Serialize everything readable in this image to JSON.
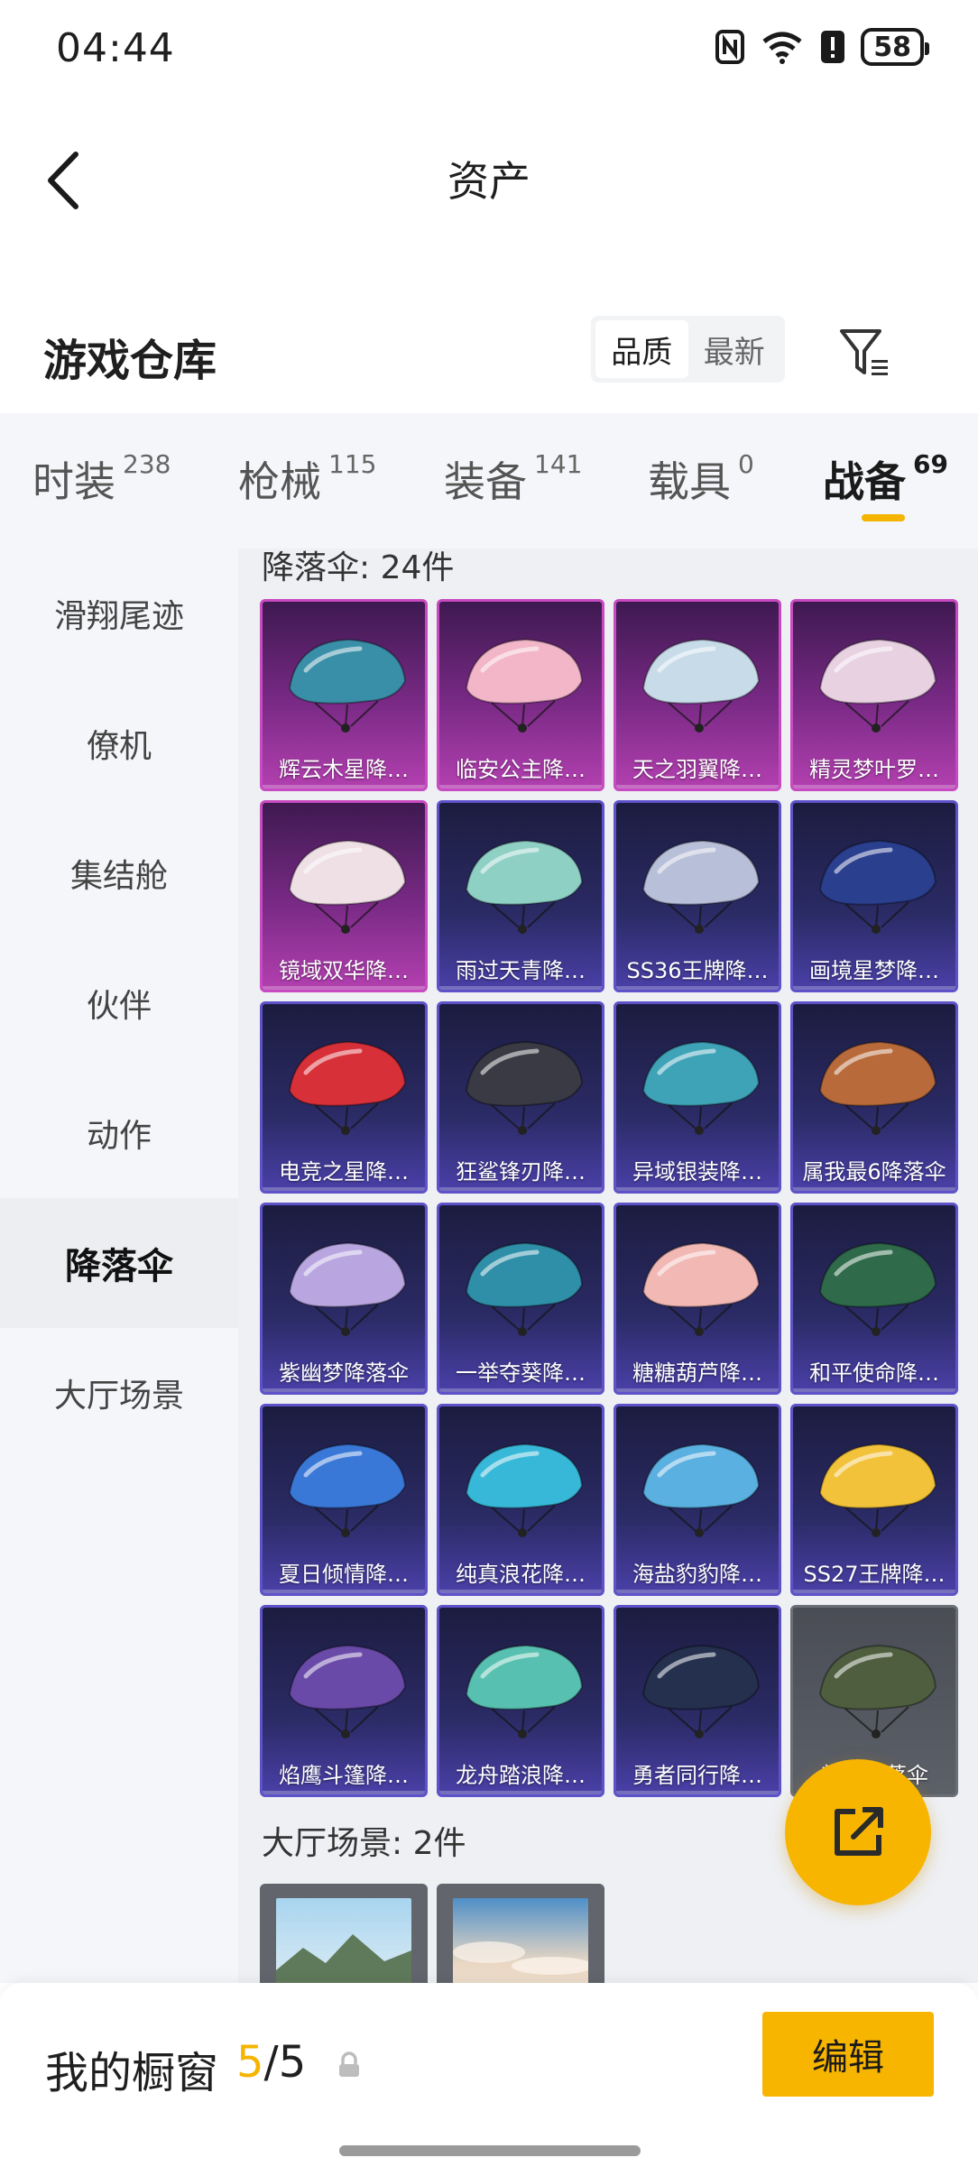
{
  "status_bar": {
    "time": "04:44",
    "battery": "58"
  },
  "header": {
    "title": "资产"
  },
  "warehouse": {
    "title": "游戏仓库",
    "sort_options": [
      "品质",
      "最新"
    ],
    "active_sort": "品质"
  },
  "tabs": [
    {
      "label": "时装",
      "count": "238"
    },
    {
      "label": "枪械",
      "count": "115"
    },
    {
      "label": "装备",
      "count": "141"
    },
    {
      "label": "载具",
      "count": "0"
    },
    {
      "label": "战备",
      "count": "69"
    }
  ],
  "active_tab": "战备",
  "sidebar": {
    "items": [
      "滑翔尾迹",
      "僚机",
      "集结舱",
      "伙伴",
      "动作",
      "降落伞",
      "大厅场景"
    ],
    "active": "降落伞"
  },
  "parachutes": {
    "section_title": "降落伞: 24件",
    "items": [
      {
        "name": "辉云木星降…",
        "rarity": "legend",
        "color": "#3a8fa8"
      },
      {
        "name": "临安公主降…",
        "rarity": "legend",
        "color": "#f2b6c8"
      },
      {
        "name": "天之羽翼降…",
        "rarity": "legend",
        "color": "#c7dbe8"
      },
      {
        "name": "精灵梦叶罗…",
        "rarity": "legend",
        "color": "#e8d2e2"
      },
      {
        "name": "镜域双华降…",
        "rarity": "legend",
        "color": "#efe0e6"
      },
      {
        "name": "雨过天青降…",
        "rarity": "epic",
        "color": "#8fd0c5"
      },
      {
        "name": "SS36王牌降…",
        "rarity": "epic",
        "color": "#b8bfd8"
      },
      {
        "name": "画境星梦降…",
        "rarity": "epic",
        "color": "#2a3f8e"
      },
      {
        "name": "电竞之星降…",
        "rarity": "epic",
        "color": "#d83038"
      },
      {
        "name": "狂鲨锋刃降…",
        "rarity": "epic",
        "color": "#3a3a44"
      },
      {
        "name": "异域银装降…",
        "rarity": "epic",
        "color": "#3fa3b8"
      },
      {
        "name": "属我最6降落伞",
        "rarity": "epic",
        "color": "#b86a3a"
      },
      {
        "name": "紫幽梦降落伞",
        "rarity": "epic",
        "color": "#b9a6e0"
      },
      {
        "name": "一举夺葵降…",
        "rarity": "epic",
        "color": "#2f8fa8"
      },
      {
        "name": "糖糖葫芦降…",
        "rarity": "epic",
        "color": "#f2b8b4"
      },
      {
        "name": "和平使命降…",
        "rarity": "epic",
        "color": "#2f6a4a"
      },
      {
        "name": "夏日倾情降…",
        "rarity": "epic",
        "color": "#3a78d8"
      },
      {
        "name": "纯真浪花降…",
        "rarity": "epic",
        "color": "#38b8d8"
      },
      {
        "name": "海盐豹豹降…",
        "rarity": "epic",
        "color": "#5ab0e0"
      },
      {
        "name": "SS27王牌降…",
        "rarity": "epic",
        "color": "#f2c23a"
      },
      {
        "name": "焰鹰斗篷降…",
        "rarity": "epic",
        "color": "#6a4aa8"
      },
      {
        "name": "龙舟踏浪降…",
        "rarity": "epic",
        "color": "#58c0b0"
      },
      {
        "name": "勇者同行降…",
        "rarity": "epic",
        "color": "#24304e"
      },
      {
        "name": "普通降落伞",
        "rarity": "common",
        "color": "#4e5e3e"
      }
    ]
  },
  "lobby_scenes": {
    "section_title": "大厅场景: 2件"
  },
  "bottom": {
    "window_label": "我的橱窗",
    "count_current": "5",
    "count_sep": "/",
    "count_total": "5",
    "edit_label": "编辑"
  }
}
